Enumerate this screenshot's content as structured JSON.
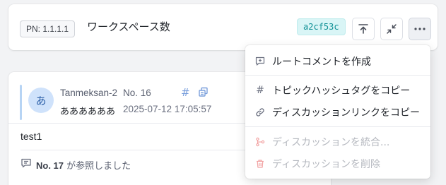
{
  "header": {
    "pn_badge": "PN: 1.1.1.1",
    "title": "ワークスペース数",
    "commit_hash": "a2cf53c"
  },
  "toolbar": {
    "icons": [
      "upload-icon",
      "collapse-icon",
      "more-icon"
    ]
  },
  "discussion": {
    "avatar_letter": "あ",
    "author": "Tanmeksan-2",
    "number": "No. 16",
    "subtitle": "ああああああ",
    "timestamp": "2025-07-12 17:05:57",
    "body": "test1",
    "reference": {
      "number": "No. 17",
      "text": "が参照しました"
    }
  },
  "menu": {
    "items": [
      {
        "label": "ルートコメントを作成",
        "icon": "comment-plus-icon",
        "disabled": false
      },
      {
        "label": "トピックハッシュタグをコピー",
        "icon": "hash-icon",
        "disabled": false
      },
      {
        "label": "ディスカッションリンクをコピー",
        "icon": "link-icon",
        "disabled": false
      },
      {
        "label": "ディスカッションを統合...",
        "icon": "merge-icon",
        "disabled": true
      },
      {
        "label": "ディスカッションを削除",
        "icon": "trash-icon",
        "disabled": true
      }
    ]
  },
  "colors": {
    "accent_blue": "#7a9fdc",
    "hash_badge_bg": "#d9f5f6",
    "hash_badge_text": "#0d8f94",
    "disabled_red_icon": "#f2a3a3"
  }
}
